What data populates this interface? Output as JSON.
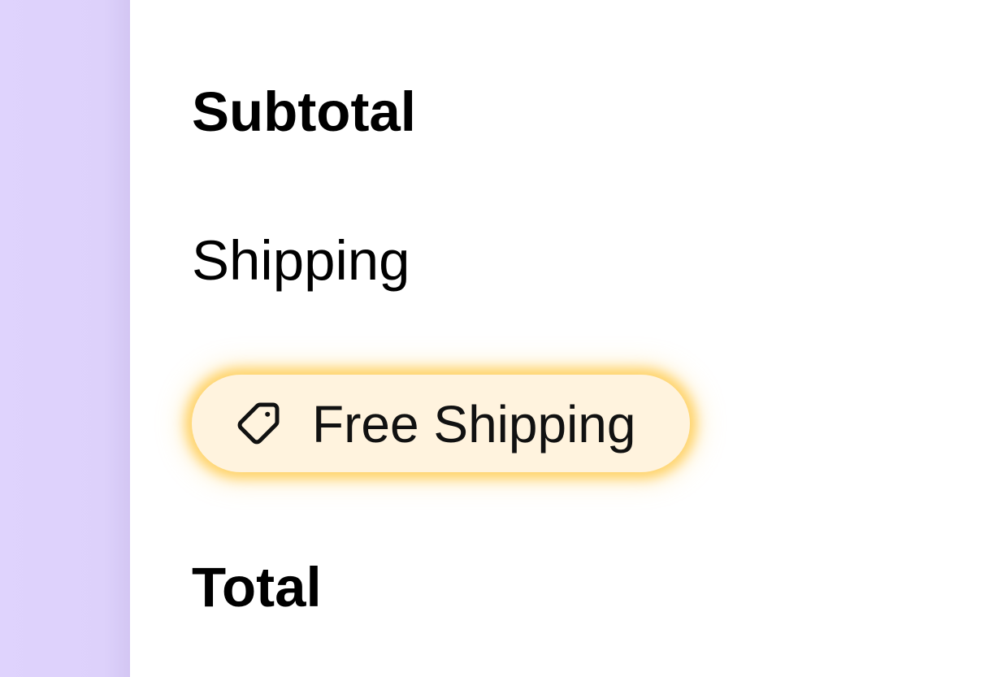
{
  "order_summary": {
    "subtotal_label": "Subtotal",
    "shipping_label": "Shipping",
    "total_label": "Total"
  },
  "promo": {
    "label": "Free Shipping",
    "icon": "tag-icon",
    "background_color": "#fff3de",
    "glow_color": "#ffc846"
  },
  "side_panel": {
    "color": "#ddd1fb"
  }
}
